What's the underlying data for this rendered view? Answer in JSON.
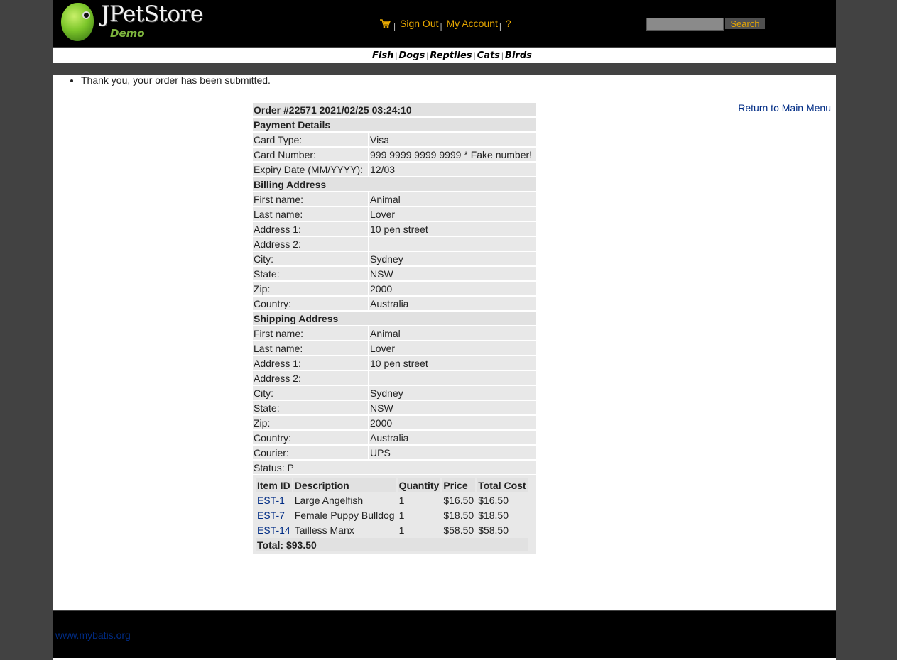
{
  "header": {
    "brand": "JPetStore",
    "brand_sub": "Demo",
    "menu": {
      "sign_out": "Sign Out",
      "my_account": "My Account",
      "help": "?",
      "sep": "|"
    },
    "search": {
      "value": "",
      "button": "Search"
    }
  },
  "categories": [
    "Fish",
    "Dogs",
    "Reptiles",
    "Cats",
    "Birds"
  ],
  "messages": [
    "Thank you, your order has been submitted."
  ],
  "return_link": "Return to Main Menu",
  "order": {
    "title": "Order #22571 2021/02/25 03:24:10",
    "payment": {
      "heading": "Payment Details",
      "rows": [
        {
          "label": "Card Type:",
          "value": "Visa"
        },
        {
          "label": "Card Number:",
          "value": "999 9999 9999 9999 * Fake number!"
        },
        {
          "label": "Expiry Date (MM/YYYY):",
          "value": "12/03"
        }
      ]
    },
    "billing": {
      "heading": "Billing Address",
      "rows": [
        {
          "label": "First name:",
          "value": "Animal"
        },
        {
          "label": "Last name:",
          "value": "Lover"
        },
        {
          "label": "Address 1:",
          "value": "10 pen street"
        },
        {
          "label": "Address 2:",
          "value": ""
        },
        {
          "label": "City:",
          "value": "Sydney"
        },
        {
          "label": "State:",
          "value": "NSW"
        },
        {
          "label": "Zip:",
          "value": "2000"
        },
        {
          "label": "Country:",
          "value": "Australia"
        }
      ]
    },
    "shipping": {
      "heading": "Shipping Address",
      "rows": [
        {
          "label": "First name:",
          "value": "Animal"
        },
        {
          "label": "Last name:",
          "value": "Lover"
        },
        {
          "label": "Address 1:",
          "value": "10 pen street"
        },
        {
          "label": "Address 2:",
          "value": ""
        },
        {
          "label": "City:",
          "value": "Sydney"
        },
        {
          "label": "State:",
          "value": "NSW"
        },
        {
          "label": "Zip:",
          "value": "2000"
        },
        {
          "label": "Country:",
          "value": "Australia"
        },
        {
          "label": "Courier:",
          "value": "UPS"
        }
      ]
    },
    "status": "Status: P",
    "items": {
      "headers": [
        "Item ID",
        "Description",
        "Quantity",
        "Price",
        "Total Cost"
      ],
      "rows": [
        {
          "id": "EST-1",
          "description": "Large Angelfish",
          "quantity": "1",
          "price": "$16.50",
          "total": "$16.50"
        },
        {
          "id": "EST-7",
          "description": "Female Puppy Bulldog",
          "quantity": "1",
          "price": "$18.50",
          "total": "$18.50"
        },
        {
          "id": "EST-14",
          "description": "Tailless Manx",
          "quantity": "1",
          "price": "$58.50",
          "total": "$58.50"
        }
      ],
      "total": "Total: $93.50"
    }
  },
  "footer": {
    "link": "www.mybatis.org"
  },
  "icons": {
    "cart": "cart-icon",
    "logo": "parrot-logo-icon"
  },
  "colors": {
    "link": "#002c85",
    "menu_link": "#e8a800",
    "header_bg": "#000000",
    "page_bg": "#424242",
    "row_bg": "#e8e8e8",
    "heading_bg": "#e1e1e1"
  }
}
